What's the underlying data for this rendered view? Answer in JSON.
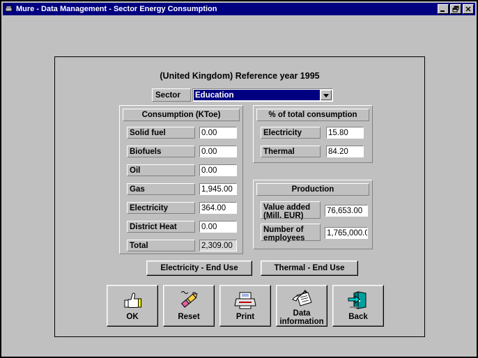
{
  "window": {
    "title": "Mure - Data Management - Sector Energy Consumption",
    "icon": "app-icon",
    "controls": {
      "minimize": "minimize-icon",
      "restore": "restore-icon",
      "close": "close-icon"
    }
  },
  "header": {
    "page_title": "(United Kingdom) Reference year  1995",
    "sector_label": "Sector",
    "sector_value": "Education",
    "sector_dropdown_icon": "chevron-down-icon"
  },
  "consumption": {
    "title": "Consumption (KToe)",
    "rows": [
      {
        "label": "Solid fuel",
        "value": "0.00",
        "readonly": false
      },
      {
        "label": "Biofuels",
        "value": "0.00",
        "readonly": false
      },
      {
        "label": "Oil",
        "value": "0.00",
        "readonly": false
      },
      {
        "label": "Gas",
        "value": "1,945.00",
        "readonly": false
      },
      {
        "label": "Electricity",
        "value": "364.00",
        "readonly": false
      },
      {
        "label": "District Heat",
        "value": "0.00",
        "readonly": false
      },
      {
        "label": "Total",
        "value": "2,309.00",
        "readonly": true
      }
    ]
  },
  "percent_of_total": {
    "title": "% of total consumption",
    "rows": [
      {
        "label": "Electricity",
        "value": "15.80"
      },
      {
        "label": "Thermal",
        "value": "84.20"
      }
    ]
  },
  "production": {
    "title": "Production",
    "rows": [
      {
        "label": "Value added\n(Mill. EUR)",
        "value": "76,653.00"
      },
      {
        "label": "Number of\nemployees",
        "value": "1,765,000.0"
      }
    ]
  },
  "end_use_buttons": {
    "electricity": "Electricity - End Use",
    "thermal": "Thermal - End Use"
  },
  "toolbar": [
    {
      "caption": "OK",
      "icon": "thumbs-up-icon"
    },
    {
      "caption": "Reset",
      "icon": "pencil-eraser-icon"
    },
    {
      "caption": "Print",
      "icon": "printer-icon"
    },
    {
      "caption": "Data\ninformation",
      "icon": "notepad-pen-icon"
    },
    {
      "caption": "Back",
      "icon": "exit-door-icon"
    }
  ],
  "colors": {
    "titlebar": "#000080",
    "face": "#c0c0c0",
    "selection": "#000080",
    "field": "#ffffff"
  }
}
